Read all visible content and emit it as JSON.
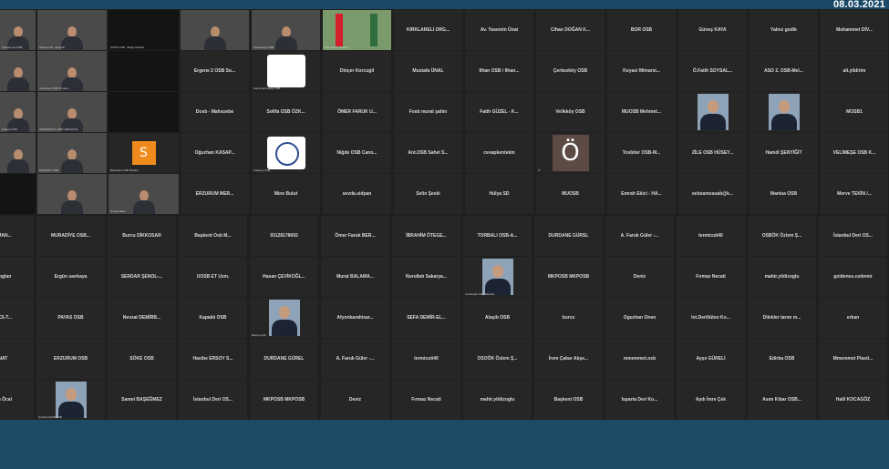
{
  "header": {
    "date": "08.03.2021"
  },
  "tiles": [
    {
      "type": "video",
      "caption": "Kastamonu OSB"
    },
    {
      "type": "video",
      "caption": "Mehmet Ali - Alaşehir"
    },
    {
      "type": "dark",
      "caption": "SİVAS OSB - Bölge Müdürü"
    },
    {
      "type": "video",
      "caption": ""
    },
    {
      "type": "video",
      "caption": "Kapadokya OSB"
    },
    {
      "type": "flags",
      "caption": "Milli Sanayi İstanbul"
    },
    {
      "type": "name",
      "label": "KIRKLARELİ ORG..."
    },
    {
      "type": "name",
      "label": "Av. Yasemin Ünat"
    },
    {
      "type": "name",
      "label": "Cihan DOĞAN K..."
    },
    {
      "type": "name",
      "label": "BOR OSB"
    },
    {
      "type": "name",
      "label": "Güneş KAYA"
    },
    {
      "type": "name",
      "label": "Yalnız godik"
    },
    {
      "type": "name",
      "label": "Muhammet DİV..."
    },
    {
      "type": "video",
      "caption": ""
    },
    {
      "type": "video",
      "caption": "Osmaniye OSB Yönetim"
    },
    {
      "type": "dark",
      "caption": ""
    },
    {
      "type": "name",
      "label": "Ergene 2 OSB So..."
    },
    {
      "type": "logo",
      "caption": "Kahramanmaraş OSB"
    },
    {
      "type": "name",
      "label": "Dinçer Korcugil"
    },
    {
      "type": "name",
      "label": "Mustafa ÜNAL"
    },
    {
      "type": "name",
      "label": "Ilhan OSB / Ilhan..."
    },
    {
      "type": "name",
      "label": "Çerkezköy OSB"
    },
    {
      "type": "name",
      "label": "Koyasi Mimarsi..."
    },
    {
      "type": "name",
      "label": "Ö.Fatih SOYSAL..."
    },
    {
      "type": "name",
      "label": "ASO 2. OSB-Mel..."
    },
    {
      "type": "name",
      "label": "ali.yildirim"
    },
    {
      "type": "video",
      "caption": "Ankara OSB"
    },
    {
      "type": "video",
      "caption": "ÇERKEZKÖY OSB ÜMRANİYE"
    },
    {
      "type": "dark",
      "caption": ""
    },
    {
      "type": "name",
      "label": "Dosb - Mahsuebe"
    },
    {
      "type": "name",
      "label": "Sofifa OSB ÖZK..."
    },
    {
      "type": "name",
      "label": "ÖMER FARUK U..."
    },
    {
      "type": "name",
      "label": "Fosb murat şahin"
    },
    {
      "type": "name",
      "label": "Fatih GÜZEL - K..."
    },
    {
      "type": "name",
      "label": "Velikköy OSB"
    },
    {
      "type": "name",
      "label": "MUOSB Mehmet..."
    },
    {
      "type": "photo",
      "caption": ""
    },
    {
      "type": "photo",
      "caption": ""
    },
    {
      "type": "name",
      "label": "MOSB1"
    },
    {
      "type": "video",
      "caption": ""
    },
    {
      "type": "video",
      "caption": "BAŞKENT OSB"
    },
    {
      "type": "orange",
      "letter": "S",
      "caption": "Bayraktar OSB Müdürü"
    },
    {
      "type": "name",
      "label": "Oğuzhan KASAP..."
    },
    {
      "type": "logo-round",
      "caption": "Kütahya OSB"
    },
    {
      "type": "name",
      "label": "Niğde OSB Cano..."
    },
    {
      "type": "name",
      "label": "Ant.OSB Sahel S..."
    },
    {
      "type": "name",
      "label": "cevapkentekin"
    },
    {
      "type": "letter",
      "letter": "Ö",
      "caption": "Ö"
    },
    {
      "type": "name",
      "label": "Tosbiter OSB-M..."
    },
    {
      "type": "name",
      "label": "ZİLE OSB HÜSEY..."
    },
    {
      "type": "name",
      "label": "Hamdi ŞENYİĞİT"
    },
    {
      "type": "name",
      "label": "VELİMEŞE OSB K..."
    },
    {
      "type": "dark",
      "caption": ""
    },
    {
      "type": "video",
      "caption": ""
    },
    {
      "type": "video",
      "caption": "Sosyal Daire"
    },
    {
      "type": "name",
      "label": "ERZURUM MER..."
    },
    {
      "type": "name",
      "label": "Mine Bulut"
    },
    {
      "type": "name",
      "label": "sevda.sidpan"
    },
    {
      "type": "name",
      "label": "Selin Şeski"
    },
    {
      "type": "name",
      "label": "Hülya SD"
    },
    {
      "type": "name",
      "label": "MUOSB"
    },
    {
      "type": "name",
      "label": "Emrah Ekici - HA..."
    },
    {
      "type": "name",
      "label": "sebsamosuab@k..."
    },
    {
      "type": "name",
      "label": "Manisa OSB"
    },
    {
      "type": "name",
      "label": "Merve TEKİN /..."
    },
    {
      "type": "name",
      "label": "...ERMAN..."
    },
    {
      "type": "name",
      "label": "MURADİYE OSB..."
    },
    {
      "type": "name",
      "label": "Burcu DİKKOSAR"
    },
    {
      "type": "name",
      "label": "Başkent Osb M..."
    },
    {
      "type": "name",
      "label": "93128178693"
    },
    {
      "type": "name",
      "label": "Ömer Faruk BER..."
    },
    {
      "type": "name",
      "label": "İBRAHİM ÖTEGE..."
    },
    {
      "type": "name",
      "label": "TORBALI OSB-A..."
    },
    {
      "type": "name",
      "label": "DURDANE GÜRSL"
    },
    {
      "type": "name",
      "label": "A. Faruk Güler -..."
    },
    {
      "type": "name",
      "label": "termicuti40"
    },
    {
      "type": "name",
      "label": "OSBÖK Özlem Ş..."
    },
    {
      "type": "name",
      "label": "İstanbul Deri OS..."
    },
    {
      "type": "name",
      "label": "Kocaoglan"
    },
    {
      "type": "name",
      "label": "Ergün sarıkaya"
    },
    {
      "type": "name",
      "label": "SERDAR ŞENOL-..."
    },
    {
      "type": "name",
      "label": "UOSB ET Uzm."
    },
    {
      "type": "name",
      "label": "Hasan ÇEVİKOĞL..."
    },
    {
      "type": "name",
      "label": "Murat BALAMA..."
    },
    {
      "type": "name",
      "label": "Nurullah Sakarya..."
    },
    {
      "type": "photo",
      "caption": "Vezirköprü OSB Müdürü"
    },
    {
      "type": "name",
      "label": "MKPOSB MKPOSB"
    },
    {
      "type": "name",
      "label": "Deniz"
    },
    {
      "type": "name",
      "label": "Fırmaz Necati"
    },
    {
      "type": "name",
      "label": "mahir.yildizoglu"
    },
    {
      "type": "name",
      "label": "goldenes.cedemir"
    },
    {
      "type": "name",
      "label": "...BOKS-T..."
    },
    {
      "type": "name",
      "label": "PAYAS OSB"
    },
    {
      "type": "name",
      "label": "Nevzat DEMİRB..."
    },
    {
      "type": "name",
      "label": "Kapaklı OSB"
    },
    {
      "type": "photo",
      "caption": "Büşra Aydın"
    },
    {
      "type": "name",
      "label": "Afyonkarahisar..."
    },
    {
      "type": "name",
      "label": "SEFA DEMİR-EL..."
    },
    {
      "type": "name",
      "label": "Alaşib OSB"
    },
    {
      "type": "name",
      "label": "burcu"
    },
    {
      "type": "name",
      "label": "Oguzhan Onen"
    },
    {
      "type": "name",
      "label": "Int.Deriliüteo Ko..."
    },
    {
      "type": "name",
      "label": "Dilekler tarım m..."
    },
    {
      "type": "name",
      "label": "erkan"
    },
    {
      "type": "name",
      "label": "...UNAT"
    },
    {
      "type": "name",
      "label": "ERZURUM OSB"
    },
    {
      "type": "name",
      "label": "SÖKE OSB"
    },
    {
      "type": "name",
      "label": "Hasibe ERSOY S..."
    },
    {
      "type": "name",
      "label": "DURDANE GÜREL"
    },
    {
      "type": "name",
      "label": "A. Faruk Güler -..."
    },
    {
      "type": "name",
      "label": "termicuti40"
    },
    {
      "type": "name",
      "label": "OSOÖK Özlem Ş..."
    },
    {
      "type": "name",
      "label": "İrem Çakar Alışe..."
    },
    {
      "type": "name",
      "label": "mmemmet.osb"
    },
    {
      "type": "name",
      "label": "Ayşe GÜRELİ"
    },
    {
      "type": "name",
      "label": "Edirba OSB"
    },
    {
      "type": "name",
      "label": "Mmemmet Plasti..."
    },
    {
      "type": "name",
      "label": "...rkan Öcal"
    },
    {
      "type": "photo",
      "caption": "Günkan KESİRTAR"
    },
    {
      "type": "name",
      "label": "Samet BAŞEĞMEZ"
    },
    {
      "type": "name",
      "label": "İstanbul Deri OS..."
    },
    {
      "type": "name",
      "label": "MKPOSB MKPOSB"
    },
    {
      "type": "name",
      "label": "Deniz"
    },
    {
      "type": "name",
      "label": "Fırmaz Necati"
    },
    {
      "type": "name",
      "label": "mahir.yildizoglu"
    },
    {
      "type": "name",
      "label": "Başkent OSB"
    },
    {
      "type": "name",
      "label": "Isparta Deri Ko..."
    },
    {
      "type": "name",
      "label": "Aydı İmre Çek"
    },
    {
      "type": "name",
      "label": "Asım Kibar OSB..."
    },
    {
      "type": "name",
      "label": "Halil KOCAGÖZ"
    }
  ]
}
